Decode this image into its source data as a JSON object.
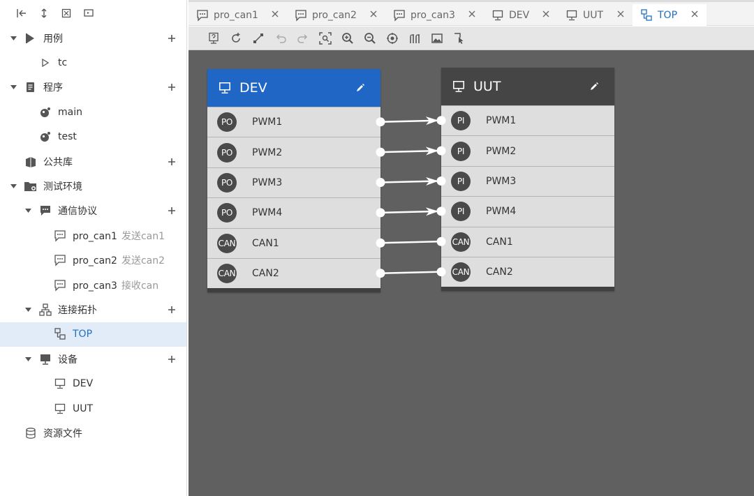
{
  "sidebar": {
    "toolbar": [
      {
        "name": "collapse-left-icon"
      },
      {
        "name": "expand-vertical-icon"
      },
      {
        "name": "collapse-all-icon"
      },
      {
        "name": "screen-icon"
      }
    ],
    "tree": [
      {
        "label": "用例",
        "sub": "",
        "icon": "play-icon",
        "caret": "down",
        "plus": true
      },
      {
        "label": "tc",
        "sub": "",
        "icon": "play-outline-icon",
        "caret": "",
        "plus": false
      },
      {
        "label": "程序",
        "sub": "",
        "icon": "program-icon",
        "caret": "down",
        "plus": true
      },
      {
        "label": "main",
        "sub": "",
        "icon": "script-icon",
        "caret": "",
        "plus": false
      },
      {
        "label": "test",
        "sub": "",
        "icon": "script-icon",
        "caret": "",
        "plus": false
      },
      {
        "label": "公共库",
        "sub": "",
        "icon": "library-icon",
        "caret": "",
        "plus": true
      },
      {
        "label": "测试环境",
        "sub": "",
        "icon": "folder-gear-icon",
        "caret": "down",
        "plus": false
      },
      {
        "label": "通信协议",
        "sub": "",
        "icon": "message-icon",
        "caret": "down",
        "plus": true
      },
      {
        "label": "pro_can1",
        "sub": "发送can1",
        "icon": "message-outline-icon",
        "caret": "",
        "plus": false
      },
      {
        "label": "pro_can2",
        "sub": "发送can2",
        "icon": "message-outline-icon",
        "caret": "",
        "plus": false
      },
      {
        "label": "pro_can3",
        "sub": "接收can",
        "icon": "message-outline-icon",
        "caret": "",
        "plus": false
      },
      {
        "label": "连接拓扑",
        "sub": "",
        "icon": "topology-icon",
        "caret": "down",
        "plus": true
      },
      {
        "label": "TOP",
        "sub": "",
        "icon": "topology-outline-icon",
        "caret": "",
        "plus": false
      },
      {
        "label": "设备",
        "sub": "",
        "icon": "device-icon",
        "caret": "down",
        "plus": true
      },
      {
        "label": "DEV",
        "sub": "",
        "icon": "monitor-icon",
        "caret": "",
        "plus": false
      },
      {
        "label": "UUT",
        "sub": "",
        "icon": "monitor-icon",
        "caret": "",
        "plus": false
      },
      {
        "label": "资源文件",
        "sub": "",
        "icon": "database-icon",
        "caret": "",
        "plus": false
      }
    ],
    "selected_index": 12
  },
  "tabs": [
    {
      "label": "pro_can1",
      "icon": "message-outline-icon",
      "active": false
    },
    {
      "label": "pro_can2",
      "icon": "message-outline-icon",
      "active": false
    },
    {
      "label": "pro_can3",
      "icon": "message-outline-icon",
      "active": false
    },
    {
      "label": "DEV",
      "icon": "monitor-icon",
      "active": false
    },
    {
      "label": "UUT",
      "icon": "monitor-icon",
      "active": false
    },
    {
      "label": "TOP",
      "icon": "topology-outline-icon",
      "active": true
    }
  ],
  "canvas_toolbar": [
    {
      "name": "help-icon"
    },
    {
      "name": "rotate-add-icon"
    },
    {
      "name": "connect-line-icon"
    },
    {
      "name": "undo-icon"
    },
    {
      "name": "redo-icon"
    },
    {
      "name": "fit-view-icon"
    },
    {
      "name": "zoom-in-icon"
    },
    {
      "name": "zoom-out-icon"
    },
    {
      "name": "target-icon"
    },
    {
      "name": "signal-icon"
    },
    {
      "name": "image-icon"
    },
    {
      "name": "pointer-icon"
    }
  ],
  "nodes": [
    {
      "name": "DEV",
      "header_color": "#1f66c5",
      "icon": "monitor-icon",
      "ports": [
        {
          "badge": "PO",
          "name": "PWM1"
        },
        {
          "badge": "PO",
          "name": "PWM2"
        },
        {
          "badge": "PO",
          "name": "PWM3"
        },
        {
          "badge": "PO",
          "name": "PWM4"
        },
        {
          "badge": "CAN",
          "name": "CAN1"
        },
        {
          "badge": "CAN",
          "name": "CAN2"
        }
      ]
    },
    {
      "name": "UUT",
      "header_color": "#454545",
      "icon": "monitor-icon",
      "ports": [
        {
          "badge": "PI",
          "name": "PWM1"
        },
        {
          "badge": "PI",
          "name": "PWM2"
        },
        {
          "badge": "PI",
          "name": "PWM3"
        },
        {
          "badge": "PI",
          "name": "PWM4"
        },
        {
          "badge": "CAN",
          "name": "CAN1"
        },
        {
          "badge": "CAN",
          "name": "CAN2"
        }
      ]
    }
  ],
  "links": [
    {
      "from": "DEV.PWM1",
      "to": "UUT.PWM1",
      "arrow": true
    },
    {
      "from": "DEV.PWM2",
      "to": "UUT.PWM2",
      "arrow": true
    },
    {
      "from": "DEV.PWM3",
      "to": "UUT.PWM3",
      "arrow": true
    },
    {
      "from": "DEV.PWM4",
      "to": "UUT.PWM4",
      "arrow": true
    },
    {
      "from": "DEV.CAN1",
      "to": "UUT.CAN1",
      "arrow": false
    },
    {
      "from": "DEV.CAN2",
      "to": "UUT.CAN2",
      "arrow": false
    }
  ],
  "colors": {
    "accent": "#1f6fc5",
    "canvas": "#606060",
    "selected_row": "#e1ecf8"
  }
}
